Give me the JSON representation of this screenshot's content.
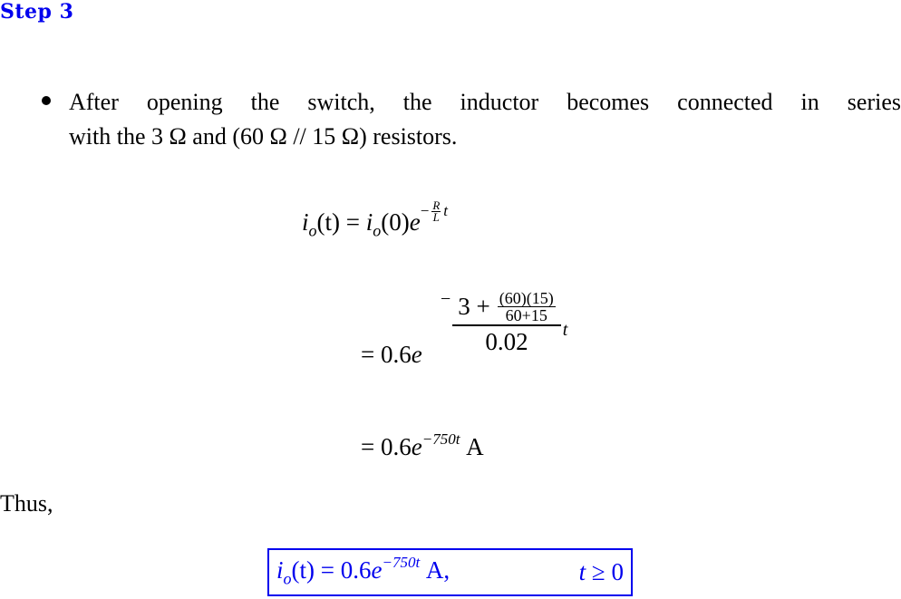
{
  "step": {
    "title": "Step 3"
  },
  "colors": {
    "accent": "#0000ee",
    "text": "#000000"
  },
  "bullet": {
    "line1": "After opening the switch, the inductor becomes connected in series",
    "line2": "with the 3 Ω and (60 Ω // 15 Ω) resistors."
  },
  "equations": {
    "eq1": {
      "lhs_var": "i",
      "lhs_sub": "o",
      "lhs_arg": "(t)",
      "equals": "=",
      "rhs_var": "i",
      "rhs_sub": "o",
      "rhs_arg": "(0)",
      "base": "e",
      "exp_sign": "−",
      "exp_num": "R",
      "exp_den": "L",
      "exp_var": "t"
    },
    "eq2": {
      "prefix": "= 0.6",
      "base": "e",
      "exp_sign": "−",
      "num_lead": "3 +",
      "inner_num": "(60)(15)",
      "inner_den": "60+15",
      "den": "0.02",
      "exp_var": "t"
    },
    "eq3": {
      "prefix": "= 0.6",
      "base": "e",
      "exponent": "−750t",
      "unit": "A"
    }
  },
  "conclusion": {
    "label": "Thus,"
  },
  "final_answer": {
    "lhs_var": "i",
    "lhs_sub": "o",
    "lhs_arg": "(t)",
    "middle": "= 0.6",
    "base": "e",
    "exponent": "−750t",
    "unit": "A,",
    "condition_var": "t",
    "condition": "≥ 0"
  }
}
